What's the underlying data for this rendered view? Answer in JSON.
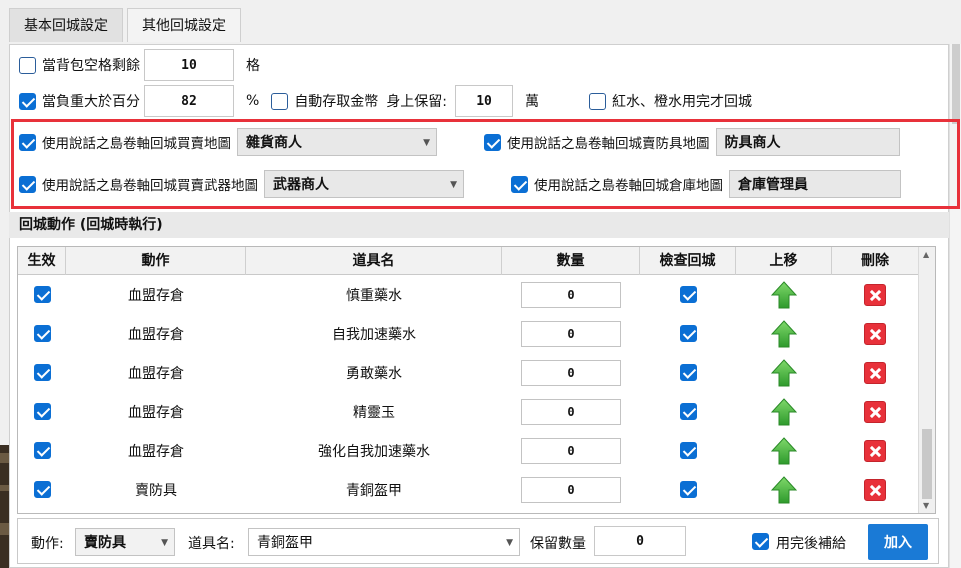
{
  "tabs": [
    {
      "label": "基本回城設定",
      "active": false
    },
    {
      "label": "其他回城設定",
      "active": true
    }
  ],
  "settings": {
    "bag_slots": {
      "label": "當背包空格剩餘",
      "checked": false,
      "value": "10",
      "unit": "格"
    },
    "weight": {
      "label": "當負重大於百分",
      "checked": true,
      "value": "82",
      "unit": "%"
    },
    "auto_gold": {
      "label": "自動存取金幣",
      "checked": false,
      "keep_label": "身上保留:",
      "value": "10",
      "unit": "萬"
    },
    "potion": {
      "label": "紅水、橙水用完才回城",
      "checked": false
    }
  },
  "scroll_settings": [
    {
      "label": "使用說話之島卷軸回城買賣地圖",
      "checked": true,
      "value": "雜貨商人"
    },
    {
      "label": "使用說話之島卷軸回城賣防具地圖",
      "checked": true,
      "value": "防具商人"
    },
    {
      "label": "使用說話之島卷軸回城買賣武器地圖",
      "checked": true,
      "value": "武器商人"
    },
    {
      "label": "使用說話之島卷軸回城倉庫地圖",
      "checked": true,
      "value": "倉庫管理員"
    }
  ],
  "section_title": "回城動作 (回城時執行)",
  "grid": {
    "headers": [
      "生效",
      "動作",
      "道具名",
      "數量",
      "檢查回城",
      "上移",
      "刪除"
    ],
    "rows": [
      {
        "enabled": true,
        "action": "血盟存倉",
        "item": "慎重藥水",
        "qty": "0",
        "check": true
      },
      {
        "enabled": true,
        "action": "血盟存倉",
        "item": "自我加速藥水",
        "qty": "0",
        "check": true
      },
      {
        "enabled": true,
        "action": "血盟存倉",
        "item": "勇敢藥水",
        "qty": "0",
        "check": true
      },
      {
        "enabled": true,
        "action": "血盟存倉",
        "item": "精靈玉",
        "qty": "0",
        "check": true
      },
      {
        "enabled": true,
        "action": "血盟存倉",
        "item": "強化自我加速藥水",
        "qty": "0",
        "check": true
      },
      {
        "enabled": true,
        "action": "賣防具",
        "item": "青銅盔甲",
        "qty": "0",
        "check": true
      }
    ]
  },
  "bottom": {
    "action_label": "動作:",
    "action_value": "賣防具",
    "item_label": "道具名:",
    "item_value": "青銅盔甲",
    "keep_label": "保留數量",
    "keep_value": "0",
    "refill_label": "用完後補給",
    "refill_checked": true,
    "add_label": "加入"
  },
  "colors": {
    "accent": "#0b6fd4",
    "highlight_border": "#e8313a",
    "add_button": "#1a7ad6",
    "delete": "#e8313a",
    "up_arrow": "#3cae3a"
  }
}
